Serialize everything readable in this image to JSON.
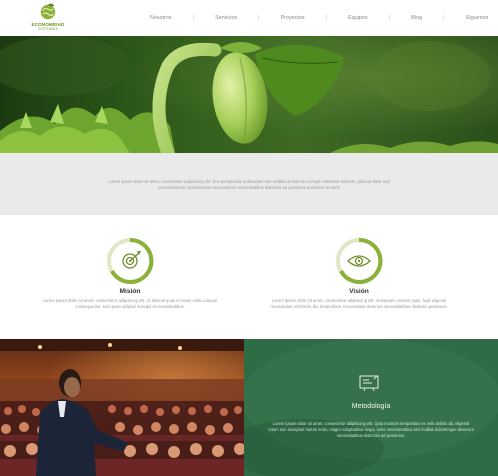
{
  "brand": {
    "title": "ECONOMIDAD",
    "subtitle": "SOSTENIBLE",
    "accent": "#7fa22a"
  },
  "nav": {
    "items": [
      {
        "label": "Nosotros"
      },
      {
        "label": "Servicios"
      },
      {
        "label": "Proyectos"
      },
      {
        "label": "Equipos"
      },
      {
        "label": "Blog"
      },
      {
        "label": "Síguenos"
      }
    ],
    "separator": "|"
  },
  "intro": {
    "text": "Lorem ipsum dolor sit amet, consectetur adipisicing elit. Eos perspiciatis quibusdam iure mollitia architecto corrupti molestias dolorum, placeat dolor sed exercitationem reprehenderit accusantium necessitatibus distinctio ad possimus provident sit sunt!"
  },
  "mission": {
    "title": "Misión",
    "icon": "target-icon",
    "text": "Lorem ipsum dolor sit amet, consectetur adipisicing elit. At deleniti quas et natus nulla cumque consequuntur, sed quam adipisci suscipit et necessitatibus."
  },
  "vision": {
    "title": "Visión",
    "icon": "eye-icon",
    "text": "Lorem ipsum dolor sit amet, consectetur adipisicing elit. Voluptates veniam optio, fugit eligendi recusandae architecto illo, temporibus, recusandae deserunt necessitatibus distinctio possimus."
  },
  "methodology": {
    "title": "Metodología",
    "icon": "chalkboard-icon",
    "background": "#2f6b45",
    "text": "Lorem ipsum dolor sit amet, consectetur adipisicing elit. Quia nostrum temporibus ex velit debitis ab, eligendi totam non excepturi harum enim, magni voluptatibus sequi, notis necessitatibus sint mollitia doloremque deserunt necessitatibus distinctio ad possimus."
  },
  "images": {
    "hero": "sprouting-seedling-photo",
    "conference": "conference-speaker-photo"
  }
}
